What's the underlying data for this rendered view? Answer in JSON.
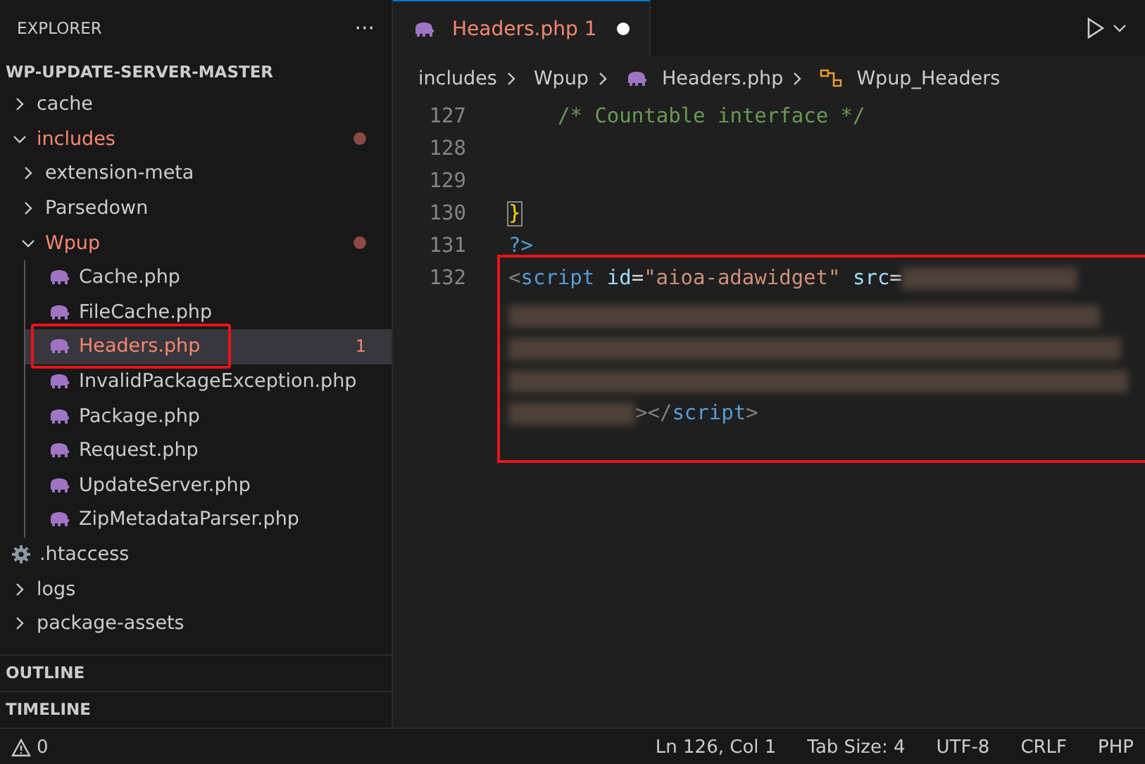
{
  "sidebar": {
    "title": "EXPLORER",
    "more": "···",
    "root": "WP-UPDATE-SERVER-MASTER",
    "tree": [
      {
        "label": "cache",
        "kind": "folder",
        "expanded": false,
        "problem": false,
        "dot": false,
        "selected": false,
        "highlighted": false
      },
      {
        "label": "includes",
        "kind": "folder",
        "expanded": true,
        "problem": true,
        "dot": true,
        "selected": false,
        "highlighted": false,
        "children": [
          {
            "label": "extension-meta",
            "kind": "folder",
            "expanded": false,
            "problem": false,
            "dot": false,
            "selected": false,
            "highlighted": false
          },
          {
            "label": "Parsedown",
            "kind": "folder",
            "expanded": false,
            "problem": false,
            "dot": false,
            "selected": false,
            "highlighted": false
          },
          {
            "label": "Wpup",
            "kind": "folder",
            "expanded": true,
            "problem": true,
            "dot": true,
            "selected": false,
            "highlighted": false,
            "children": [
              {
                "label": "Cache.php",
                "kind": "php",
                "problem": false,
                "selected": false,
                "highlighted": false
              },
              {
                "label": "FileCache.php",
                "kind": "php",
                "problem": false,
                "selected": false,
                "highlighted": false
              },
              {
                "label": "Headers.php",
                "kind": "php",
                "problem": true,
                "badge": "1",
                "selected": true,
                "highlighted": true
              },
              {
                "label": "InvalidPackageException.php",
                "kind": "php",
                "problem": false,
                "selected": false,
                "highlighted": false
              },
              {
                "label": "Package.php",
                "kind": "php",
                "problem": false,
                "selected": false,
                "highlighted": false
              },
              {
                "label": "Request.php",
                "kind": "php",
                "problem": false,
                "selected": false,
                "highlighted": false
              },
              {
                "label": "UpdateServer.php",
                "kind": "php",
                "problem": false,
                "selected": false,
                "highlighted": false
              },
              {
                "label": "ZipMetadataParser.php",
                "kind": "php",
                "problem": false,
                "selected": false,
                "highlighted": false
              }
            ]
          }
        ]
      },
      {
        "label": ".htaccess",
        "kind": "config",
        "problem": false,
        "selected": false,
        "highlighted": false
      },
      {
        "label": "logs",
        "kind": "folder",
        "expanded": false,
        "problem": false,
        "dot": false,
        "selected": false,
        "highlighted": false
      },
      {
        "label": "package-assets",
        "kind": "folder",
        "expanded": false,
        "problem": false,
        "dot": false,
        "selected": false,
        "highlighted": false
      }
    ],
    "sections": [
      "OUTLINE",
      "TIMELINE"
    ]
  },
  "tabs": [
    {
      "label": "Headers.php",
      "badge": "1",
      "dirty": true,
      "selected": true
    }
  ],
  "breadcrumbs": [
    {
      "kind": "folder",
      "label": "includes"
    },
    {
      "kind": "folder",
      "label": "Wpup"
    },
    {
      "kind": "php",
      "label": "Headers.php"
    },
    {
      "kind": "class",
      "label": "Wpup_Headers"
    }
  ],
  "code": [
    {
      "number": "127",
      "tokens": [
        {
          "kind": "comment",
          "text": "/* Countable interface */"
        }
      ],
      "highlighted": false
    },
    {
      "number": "128",
      "highlighted": false
    },
    {
      "number": "129",
      "highlighted": false
    },
    {
      "number": "130",
      "tokens": [
        {
          "kind": "bracket",
          "text": "}"
        }
      ],
      "highlighted": false
    },
    {
      "number": "131",
      "tokens": [
        {
          "kind": "keyword",
          "text": "?>"
        }
      ],
      "highlighted": false
    },
    {
      "number": "132",
      "tokens": [
        {
          "kind": "punct",
          "text": "<"
        },
        {
          "kind": "tag",
          "text": "script"
        },
        {
          "kind": "attr",
          "text": " id"
        },
        {
          "kind": "plain",
          "text": "="
        },
        {
          "kind": "string",
          "text": "\"aioa-adawidget\""
        },
        {
          "kind": "attr",
          "text": " src"
        },
        {
          "kind": "plain",
          "text": "="
        },
        {
          "kind": "blurred"
        },
        {
          "kind": "punct",
          "text": "></"
        },
        {
          "kind": "tag",
          "text": "script"
        },
        {
          "kind": "punct",
          "text": ">"
        }
      ],
      "highlighted": true
    }
  ],
  "status_bar": {
    "problems": "0",
    "items": [
      "Ln 126, Col 1",
      "Tab Size: 4",
      "UTF-8",
      "CRLF",
      "PHP"
    ]
  }
}
